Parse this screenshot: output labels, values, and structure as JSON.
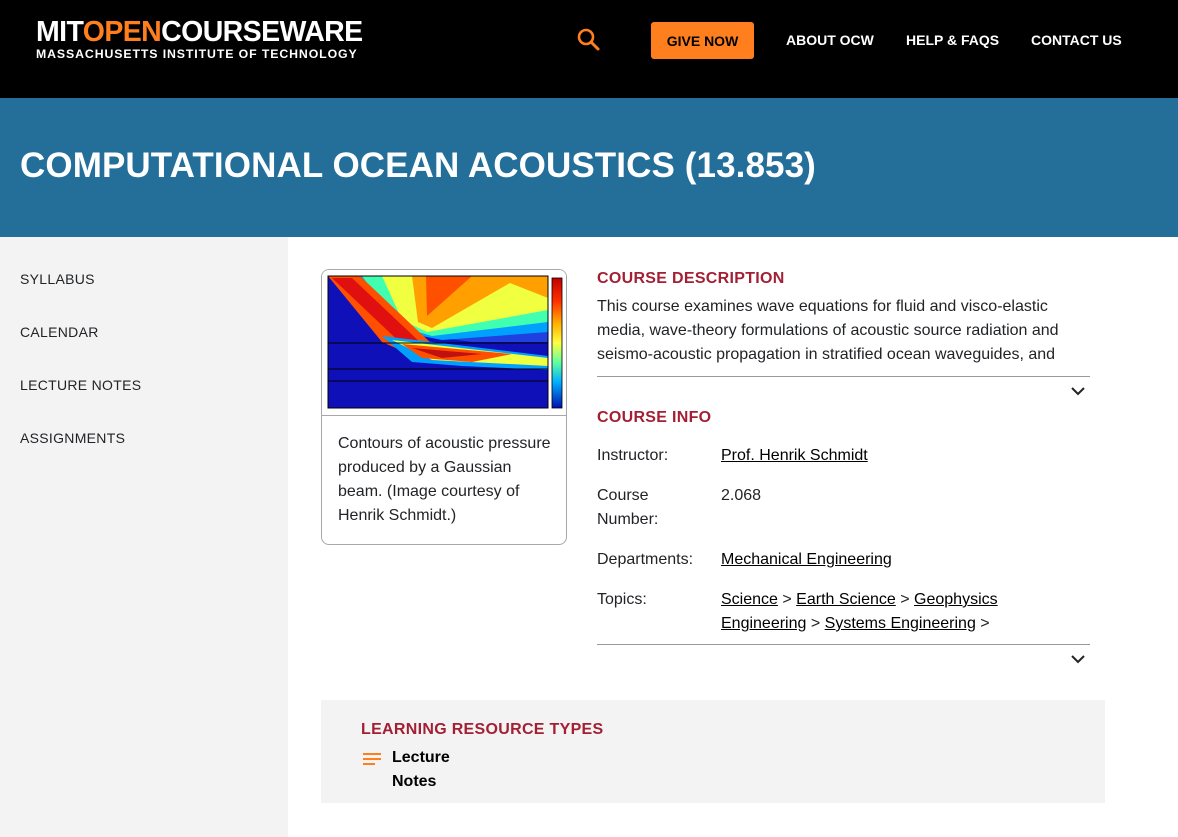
{
  "header": {
    "logo_open_prefix": "MIT",
    "logo_open_accent": "OPEN",
    "logo_open_suffix": "COURSEWARE",
    "logo_sub": "MASSACHUSETTS INSTITUTE OF TECHNOLOGY",
    "search_icon": "search-icon",
    "give_label": "GIVE NOW",
    "nav": [
      "ABOUT OCW",
      "HELP & FAQS",
      "CONTACT US"
    ]
  },
  "course": {
    "title": "COMPUTATIONAL OCEAN ACOUSTICS (13.853)"
  },
  "sidebar": {
    "items": [
      "SYLLABUS",
      "CALENDAR",
      "LECTURE NOTES",
      "ASSIGNMENTS"
    ]
  },
  "image": {
    "caption": "Contours of acoustic pressure produced by a Gaussian beam. (Image courtesy of Henrik Schmidt.)"
  },
  "description": {
    "heading": "COURSE DESCRIPTION",
    "text": "This course examines wave equations for fluid and visco-elastic media, wave-theory formulations of acoustic source radiation and seismo-acoustic propagation in stratified ocean waveguides, and",
    "expand_icon": "chevron-down-icon"
  },
  "info": {
    "heading": "COURSE INFO",
    "instructor_label": "Instructor:",
    "instructor": "Prof. Henrik Schmidt",
    "number_label": "Course Number:",
    "number": "2.068",
    "departments_label": "Departments:",
    "department": "Mechanical Engineering",
    "topics_label": "Topics:",
    "topic_1_a": "Science",
    "topic_1_b": "Earth Science",
    "topic_1_c": "Geophysics",
    "topic_2_a": "Engineering",
    "topic_2_b": "Systems Engineering",
    "separator": ">",
    "expand_icon": "chevron-down-icon"
  },
  "resources": {
    "heading": "LEARNING RESOURCE TYPES",
    "item_icon": "lines-icon",
    "item": "Lecture Notes"
  },
  "colors": {
    "header_bg": "#000000",
    "accent_orange": "#ff7f1e",
    "banner_blue": "#236f9a",
    "heading_red": "#a31f34",
    "sidebar_bg": "#f3f3f3"
  }
}
